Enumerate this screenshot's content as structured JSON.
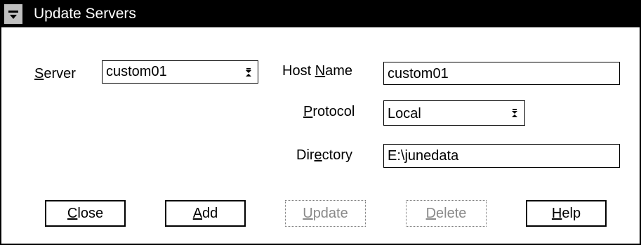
{
  "window": {
    "title": "Update Servers"
  },
  "fields": {
    "server": {
      "label_pre": "",
      "label_mn": "S",
      "label_post": "erver",
      "value": "custom01"
    },
    "host_name": {
      "label_pre": "Host ",
      "label_mn": "N",
      "label_post": "ame",
      "value": "custom01"
    },
    "protocol": {
      "label_pre": "",
      "label_mn": "P",
      "label_post": "rotocol",
      "value": "Local"
    },
    "directory": {
      "label_pre": "Dir",
      "label_mn": "e",
      "label_post": "ctory",
      "value": "E:\\junedata"
    }
  },
  "buttons": {
    "close": {
      "mn": "C",
      "rest": "lose",
      "enabled": true
    },
    "add": {
      "mn": "A",
      "rest": "dd",
      "enabled": true
    },
    "update": {
      "mn": "U",
      "rest": "pdate",
      "enabled": false
    },
    "delete": {
      "mn": "D",
      "rest": "elete",
      "enabled": false
    },
    "help": {
      "mn": "H",
      "rest": "elp",
      "enabled": true
    }
  }
}
